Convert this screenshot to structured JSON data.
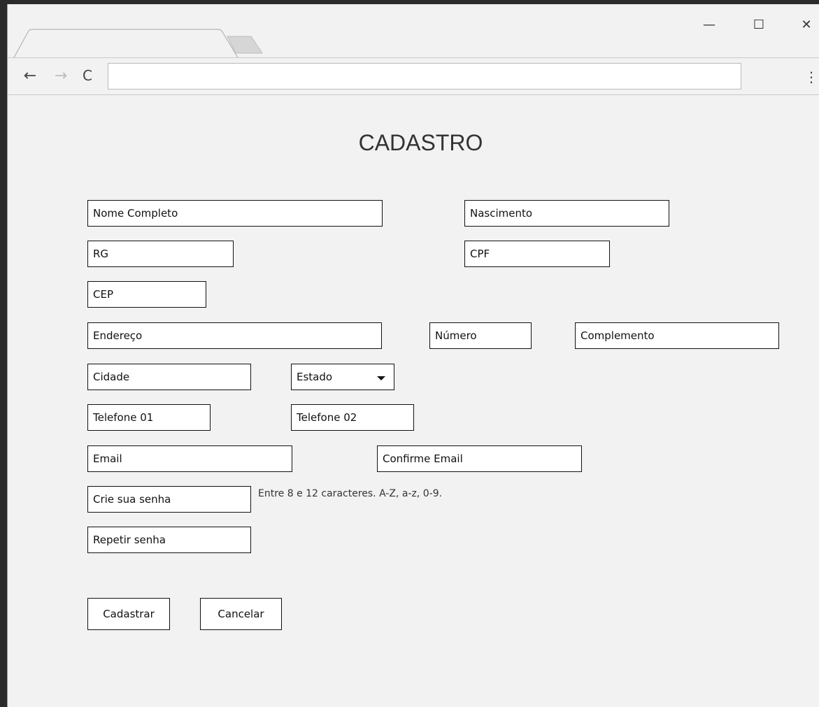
{
  "browser": {
    "window_controls": {
      "minimize": "—",
      "maximize": "☐",
      "close": "✕"
    },
    "nav": {
      "back": "←",
      "forward": "→",
      "reload": "C",
      "menu": "⋮"
    },
    "address_value": ""
  },
  "page": {
    "title": "CADASTRO",
    "fields": {
      "nome": "Nome Completo",
      "nascimento": "Nascimento",
      "rg": "RG",
      "cpf": "CPF",
      "cep": "CEP",
      "endereco": "Endereço",
      "numero": "Número",
      "complemento": "Complemento",
      "cidade": "Cidade",
      "estado": "Estado",
      "telefone1": "Telefone 01",
      "telefone2": "Telefone 02",
      "email": "Email",
      "confirme_email": "Confirme Email",
      "senha": "Crie sua senha",
      "repetir_senha": "Repetir senha"
    },
    "password_hint": "Entre 8 e 12 caracteres. A-Z, a-z, 0-9.",
    "buttons": {
      "submit": "Cadastrar",
      "cancel": "Cancelar"
    }
  },
  "icons": {
    "minimize": "minimize-icon",
    "maximize": "maximize-icon",
    "close": "close-icon",
    "back": "back-arrow-icon",
    "forward": "forward-arrow-icon",
    "reload": "reload-icon",
    "menu": "kebab-menu-icon",
    "dropdown": "chevron-down-icon"
  },
  "colors": {
    "page_background": "#f2f2f2",
    "desktop_background": "#2b2b2b",
    "field_border": "#111111"
  }
}
